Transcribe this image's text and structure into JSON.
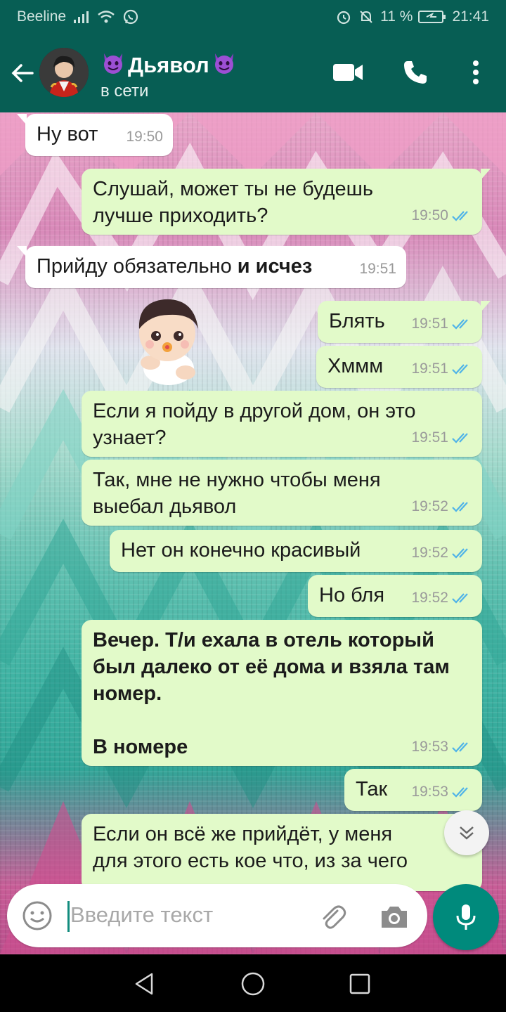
{
  "status_bar": {
    "carrier": "Beeline",
    "battery": "11 %",
    "time": "21:41"
  },
  "header": {
    "contact_name": "Дьявол",
    "status": "в сети"
  },
  "messages": [
    {
      "dir": "in",
      "text": "Ну вот",
      "time": "19:50"
    },
    {
      "dir": "out",
      "lines": [
        "Слушай, может ты не будешь",
        "лучше приходить?"
      ],
      "time": "19:50"
    },
    {
      "dir": "in",
      "text_plain": "Прийду обязательно ",
      "text_bold": "и исчез",
      "time": "19:51"
    },
    {
      "dir": "out",
      "text": "Блять",
      "time": "19:51"
    },
    {
      "dir": "out",
      "text": "Хммм",
      "time": "19:51"
    },
    {
      "dir": "out",
      "lines": [
        "Если я пойду в другой дом, он это",
        "узнает?"
      ],
      "time": "19:51"
    },
    {
      "dir": "out",
      "lines": [
        "Так, мне не нужно чтобы меня",
        "выебал дьявол"
      ],
      "time": "19:52"
    },
    {
      "dir": "out",
      "text": "Нет он конечно красивый",
      "time": "19:52"
    },
    {
      "dir": "out",
      "text": "Но бля",
      "time": "19:52"
    },
    {
      "dir": "out",
      "lines": [
        "Вечер. Т/и ехала в отель который",
        "был далеко от её дома и взяла там",
        "номер.",
        "В номере"
      ],
      "time": "19:53",
      "bold": true
    },
    {
      "dir": "out",
      "text": "Так",
      "time": "19:53"
    },
    {
      "dir": "out",
      "lines": [
        "Если он всё же прийдёт, у меня",
        "для этого есть кое что, из за чего"
      ],
      "time": ""
    }
  ],
  "input": {
    "placeholder": "Введите текст"
  },
  "colors": {
    "header": "#075e54",
    "outgoing_bubble": "#e2fac9",
    "incoming_bubble": "#ffffff",
    "mic_button": "#008a7c",
    "read_ticks": "#4fb3e8"
  },
  "icons": [
    "back-arrow-icon",
    "video-call-icon",
    "phone-icon",
    "more-vert-icon",
    "emoji-icon",
    "attach-icon",
    "camera-icon",
    "mic-icon",
    "double-chevron-down-icon",
    "nav-back-icon",
    "nav-home-icon",
    "nav-recent-icon"
  ]
}
